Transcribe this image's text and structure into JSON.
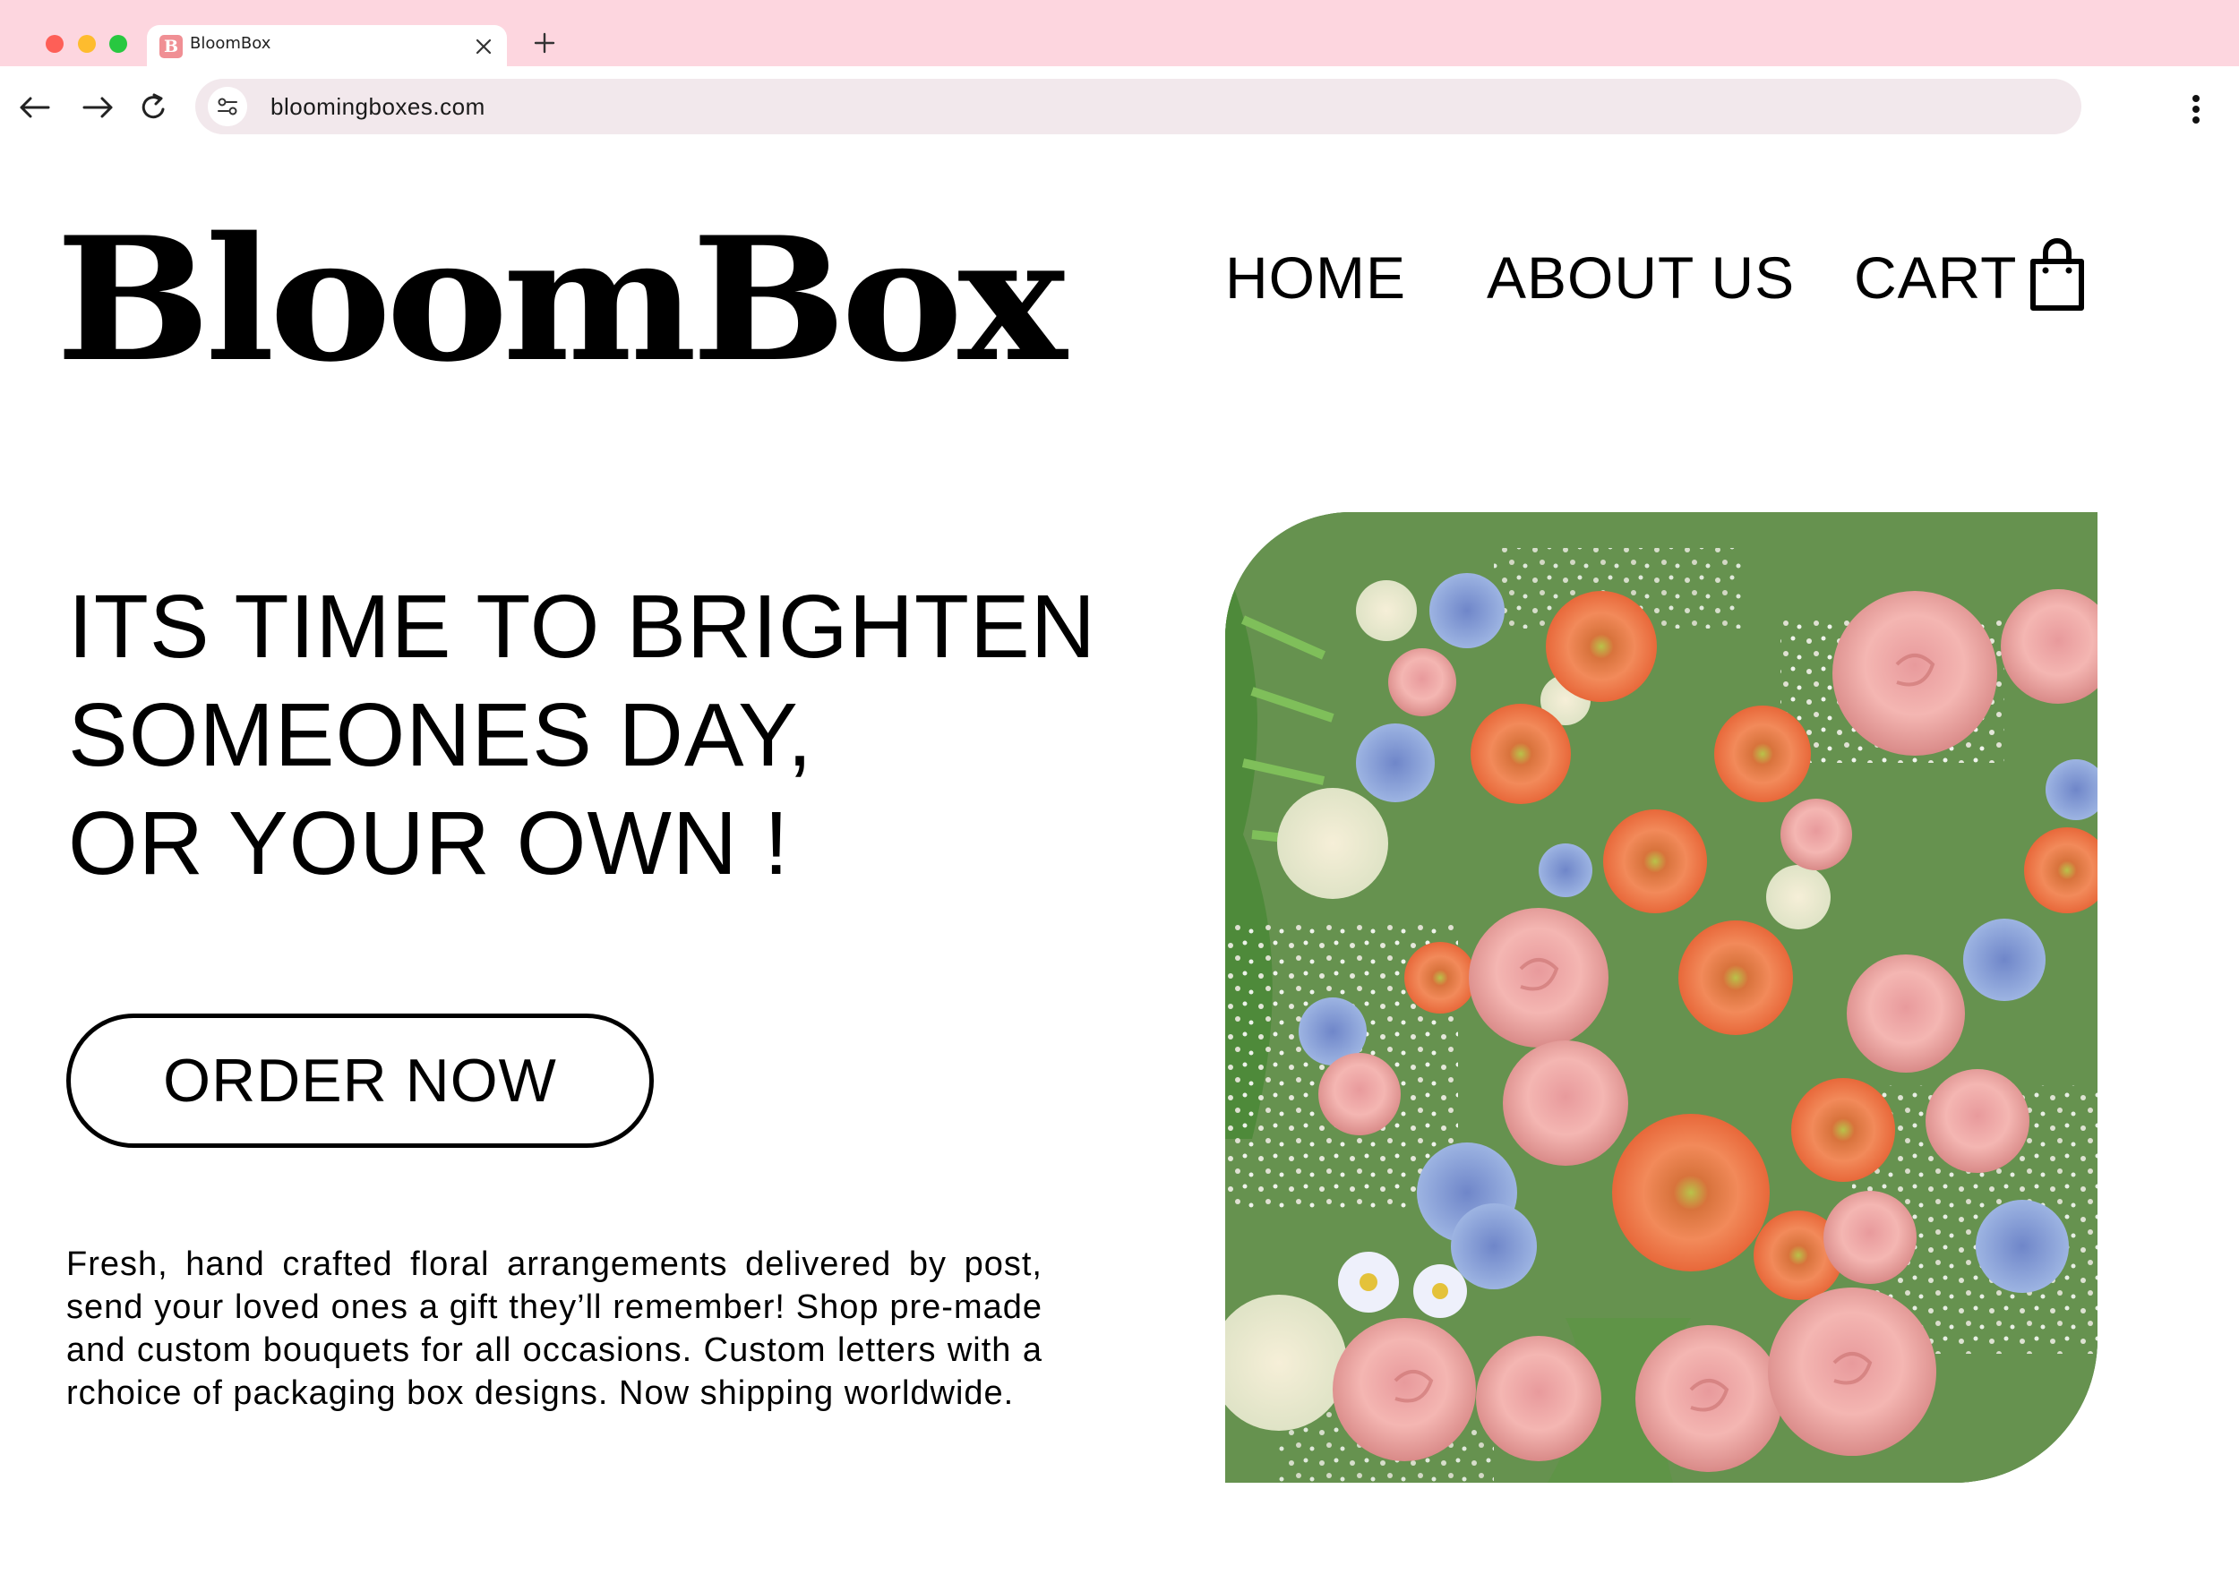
{
  "browser": {
    "tab_title": "BloomBox",
    "tab_favicon_letter": "B",
    "url": "bloomingboxes.com"
  },
  "site": {
    "logo_text": "BloomBox",
    "nav": {
      "home": "HOME",
      "about": "ABOUT US",
      "cart": "CART"
    }
  },
  "hero": {
    "headline_lines": [
      "ITS TIME TO BRIGHTEN",
      "SOMEONES DAY,",
      "OR YOUR OWN !"
    ],
    "cta_label": "ORDER NOW",
    "description": "Fresh, hand crafted floral arrangements delivered by post, send your loved ones a gift they’ll remember! Shop pre-made and custom bouquets for all occasions. Custom letters with a rchoice of packaging box designs. Now shipping worldwide."
  },
  "colors": {
    "browser_chrome": "#fdd6df",
    "address_bar": "#f2e8ec",
    "favicon": "#f08f94"
  },
  "icons": {
    "back": "arrow-left-icon",
    "forward": "arrow-right-icon",
    "reload": "reload-icon",
    "site_settings": "tune-icon",
    "menu": "kebab-menu-icon",
    "cart": "shopping-bag-icon",
    "tab_close": "close-icon",
    "new_tab": "plus-icon"
  }
}
